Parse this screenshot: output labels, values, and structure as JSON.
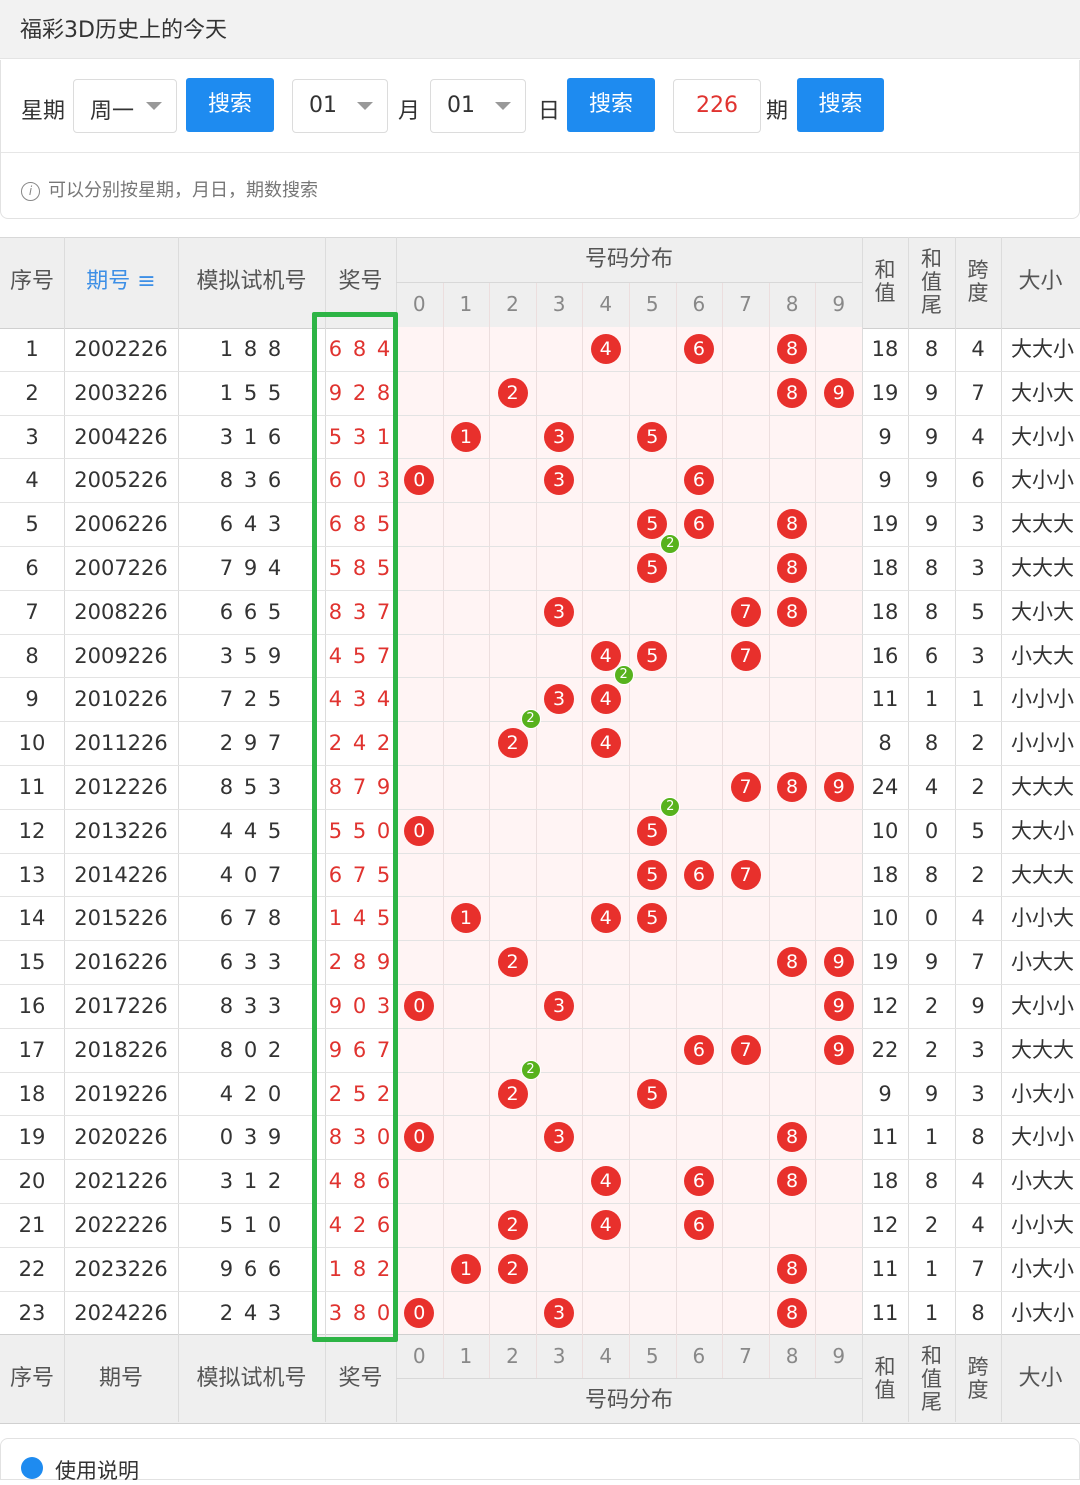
{
  "page_title": "福彩3D历史上的今天",
  "search": {
    "weekday_label": "星期",
    "weekday_value": "周一",
    "search_btn": "搜索",
    "month_value": "01",
    "month_label": "月",
    "day_value": "01",
    "day_label": "日",
    "issue_value": "226",
    "issue_label": "期",
    "hint": "可以分别按星期，月日，期数搜索"
  },
  "table": {
    "headers": {
      "seq": "序号",
      "issue": "期号",
      "trial": "模拟试机号",
      "prize": "奖号",
      "dist": "号码分布",
      "sum": "和值",
      "sum_tail": "和值尾",
      "span": "跨度",
      "size": "大小",
      "digits": [
        "0",
        "1",
        "2",
        "3",
        "4",
        "5",
        "6",
        "7",
        "8",
        "9"
      ]
    },
    "sort_icon": "sort-icon",
    "rows": [
      {
        "seq": "1",
        "issue": "2002226",
        "trial": "1 8 8",
        "prize": "6 8 4",
        "sum": "18",
        "tail": "8",
        "span": "4",
        "size": "大大小",
        "balls": [
          4,
          6,
          8
        ]
      },
      {
        "seq": "2",
        "issue": "2003226",
        "trial": "1 5 5",
        "prize": "9 2 8",
        "sum": "19",
        "tail": "9",
        "span": "7",
        "size": "大小大",
        "balls": [
          2,
          8,
          9
        ]
      },
      {
        "seq": "3",
        "issue": "2004226",
        "trial": "3 1 6",
        "prize": "5 3 1",
        "sum": "9",
        "tail": "9",
        "span": "4",
        "size": "大小小",
        "balls": [
          1,
          3,
          5
        ]
      },
      {
        "seq": "4",
        "issue": "2005226",
        "trial": "8 3 6",
        "prize": "6 0 3",
        "sum": "9",
        "tail": "9",
        "span": "6",
        "size": "大小小",
        "balls": [
          0,
          3,
          6
        ]
      },
      {
        "seq": "5",
        "issue": "2006226",
        "trial": "6 4 3",
        "prize": "6 8 5",
        "sum": "19",
        "tail": "9",
        "span": "3",
        "size": "大大大",
        "balls": [
          5,
          6,
          8
        ]
      },
      {
        "seq": "6",
        "issue": "2007226",
        "trial": "7 9 4",
        "prize": "5 8 5",
        "sum": "18",
        "tail": "8",
        "span": "3",
        "size": "大大大",
        "balls": [
          5,
          8
        ],
        "dup": 5
      },
      {
        "seq": "7",
        "issue": "2008226",
        "trial": "6 6 5",
        "prize": "8 3 7",
        "sum": "18",
        "tail": "8",
        "span": "5",
        "size": "大小大",
        "balls": [
          3,
          7,
          8
        ]
      },
      {
        "seq": "8",
        "issue": "2009226",
        "trial": "3 5 9",
        "prize": "4 5 7",
        "sum": "16",
        "tail": "6",
        "span": "3",
        "size": "小大大",
        "balls": [
          4,
          5,
          7
        ]
      },
      {
        "seq": "9",
        "issue": "2010226",
        "trial": "7 2 5",
        "prize": "4 3 4",
        "sum": "11",
        "tail": "1",
        "span": "1",
        "size": "小小小",
        "balls": [
          3,
          4
        ],
        "dup": 4
      },
      {
        "seq": "10",
        "issue": "2011226",
        "trial": "2 9 7",
        "prize": "2 4 2",
        "sum": "8",
        "tail": "8",
        "span": "2",
        "size": "小小小",
        "balls": [
          2,
          4
        ],
        "dup": 2
      },
      {
        "seq": "11",
        "issue": "2012226",
        "trial": "8 5 3",
        "prize": "8 7 9",
        "sum": "24",
        "tail": "4",
        "span": "2",
        "size": "大大大",
        "balls": [
          7,
          8,
          9
        ]
      },
      {
        "seq": "12",
        "issue": "2013226",
        "trial": "4 4 5",
        "prize": "5 5 0",
        "sum": "10",
        "tail": "0",
        "span": "5",
        "size": "大大小",
        "balls": [
          0,
          5
        ],
        "dup": 5
      },
      {
        "seq": "13",
        "issue": "2014226",
        "trial": "4 0 7",
        "prize": "6 7 5",
        "sum": "18",
        "tail": "8",
        "span": "2",
        "size": "大大大",
        "balls": [
          5,
          6,
          7
        ]
      },
      {
        "seq": "14",
        "issue": "2015226",
        "trial": "6 7 8",
        "prize": "1 4 5",
        "sum": "10",
        "tail": "0",
        "span": "4",
        "size": "小小大",
        "balls": [
          1,
          4,
          5
        ]
      },
      {
        "seq": "15",
        "issue": "2016226",
        "trial": "6 3 3",
        "prize": "2 8 9",
        "sum": "19",
        "tail": "9",
        "span": "7",
        "size": "小大大",
        "balls": [
          2,
          8,
          9
        ]
      },
      {
        "seq": "16",
        "issue": "2017226",
        "trial": "8 3 3",
        "prize": "9 0 3",
        "sum": "12",
        "tail": "2",
        "span": "9",
        "size": "大小小",
        "balls": [
          0,
          3,
          9
        ]
      },
      {
        "seq": "17",
        "issue": "2018226",
        "trial": "8 0 2",
        "prize": "9 6 7",
        "sum": "22",
        "tail": "2",
        "span": "3",
        "size": "大大大",
        "balls": [
          6,
          7,
          9
        ]
      },
      {
        "seq": "18",
        "issue": "2019226",
        "trial": "4 2 0",
        "prize": "2 5 2",
        "sum": "9",
        "tail": "9",
        "span": "3",
        "size": "小大小",
        "balls": [
          2,
          5
        ],
        "dup": 2
      },
      {
        "seq": "19",
        "issue": "2020226",
        "trial": "0 3 9",
        "prize": "8 3 0",
        "sum": "11",
        "tail": "1",
        "span": "8",
        "size": "大小小",
        "balls": [
          0,
          3,
          8
        ]
      },
      {
        "seq": "20",
        "issue": "2021226",
        "trial": "3 1 2",
        "prize": "4 8 6",
        "sum": "18",
        "tail": "8",
        "span": "4",
        "size": "小大大",
        "balls": [
          4,
          6,
          8
        ]
      },
      {
        "seq": "21",
        "issue": "2022226",
        "trial": "5 1 0",
        "prize": "4 2 6",
        "sum": "12",
        "tail": "2",
        "span": "4",
        "size": "小小大",
        "balls": [
          2,
          4,
          6
        ]
      },
      {
        "seq": "22",
        "issue": "2023226",
        "trial": "9 6 6",
        "prize": "1 8 2",
        "sum": "11",
        "tail": "1",
        "span": "7",
        "size": "小大小",
        "balls": [
          1,
          2,
          8
        ]
      },
      {
        "seq": "23",
        "issue": "2024226",
        "trial": "2 4 3",
        "prize": "3 8 0",
        "sum": "11",
        "tail": "1",
        "span": "8",
        "size": "小大小",
        "balls": [
          0,
          3,
          8
        ]
      }
    ]
  },
  "footer_card": {
    "title": "使用说明"
  },
  "colors": {
    "ball_red": "#e8302c",
    "ball_green": "#57b21d",
    "accent_blue": "#1e8bf0",
    "highlight_green": "#2db445"
  }
}
